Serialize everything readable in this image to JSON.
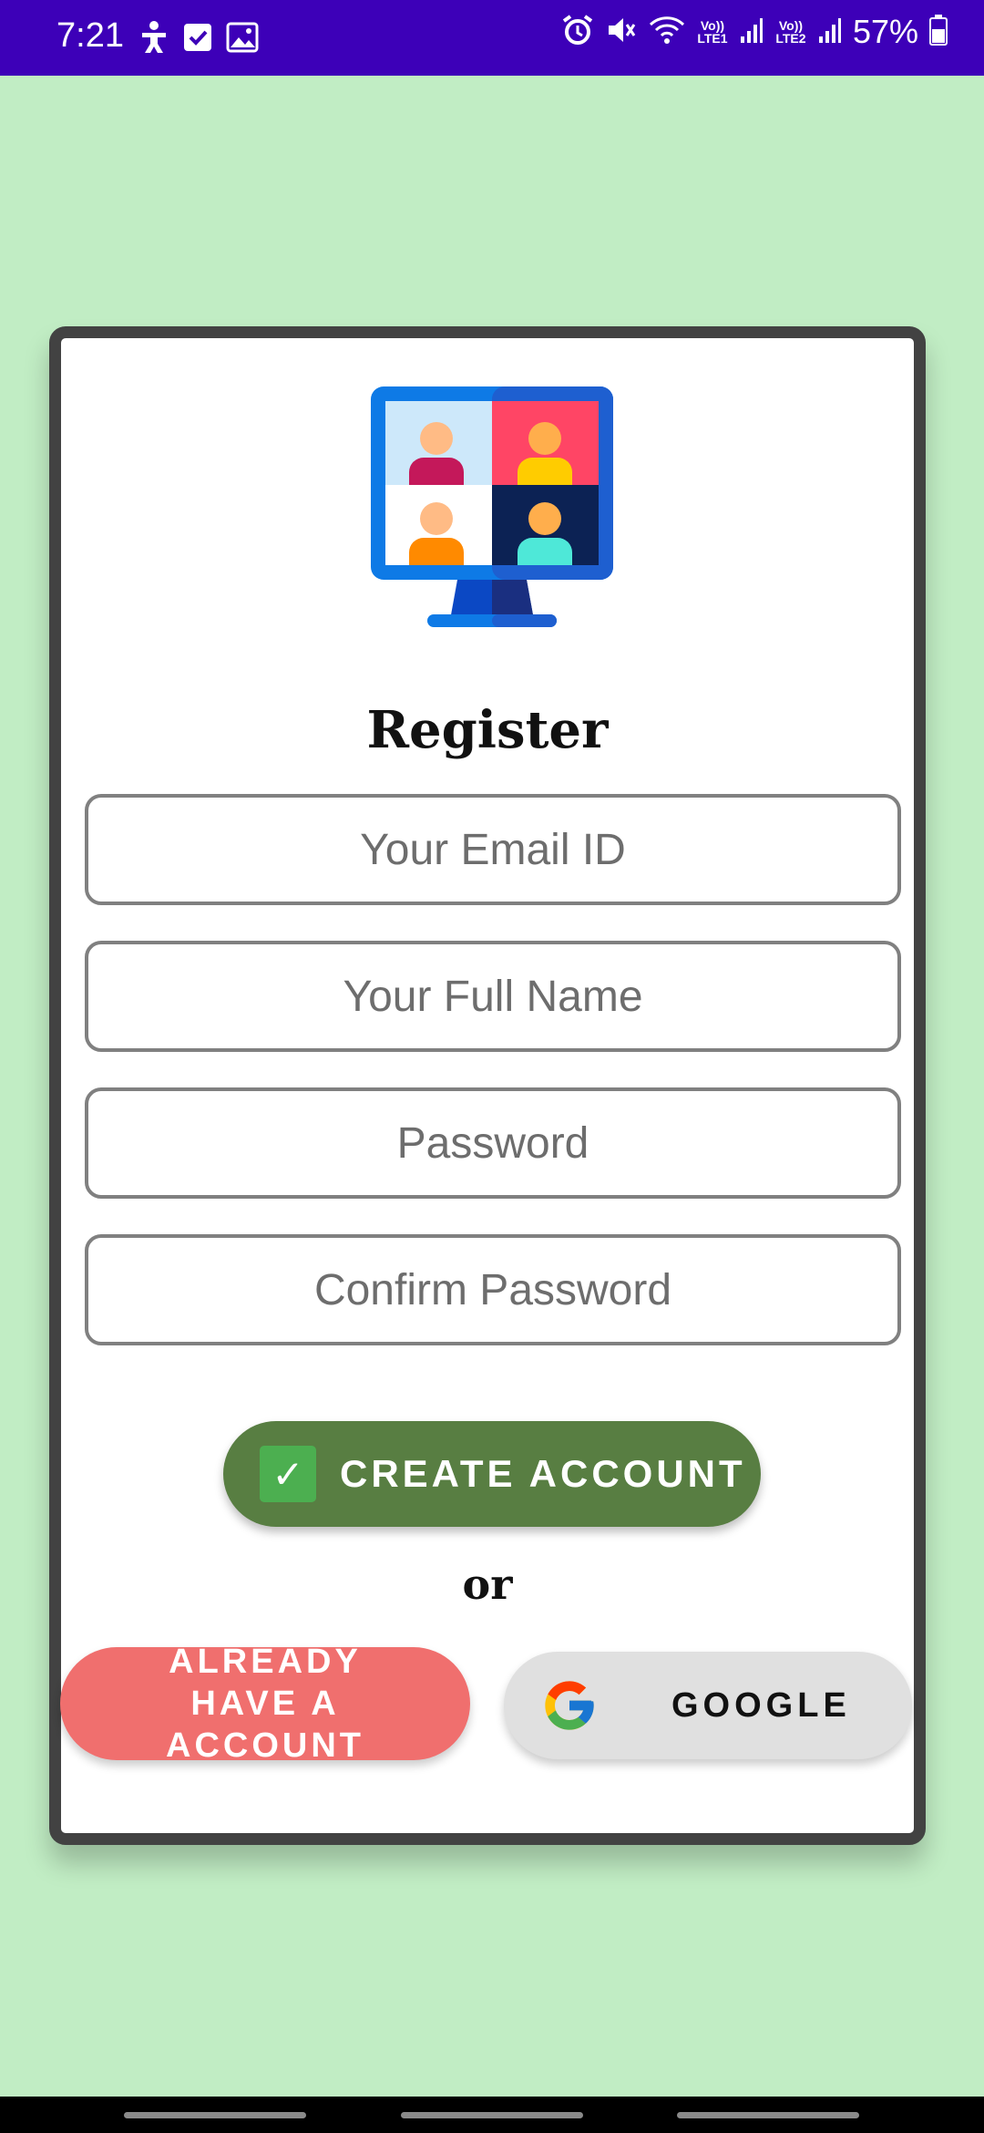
{
  "status_bar": {
    "time": "7:21",
    "battery": "57%",
    "sim1_label": "Vo)) LTE1",
    "sim2_label": "Vo)) LTE2",
    "icons": [
      "accessibility-icon",
      "checkbox-icon",
      "image-icon",
      "alarm-icon",
      "mute-icon",
      "wifi-icon",
      "signal-icon",
      "battery-icon"
    ]
  },
  "form": {
    "title": "Register",
    "email_placeholder": "Your Email ID",
    "name_placeholder": "Your Full Name",
    "password_placeholder": "Password",
    "confirm_placeholder": "Confirm Password",
    "create_label": "CREATE ACCOUNT",
    "or_text": "or",
    "already_label": "ALREADY HAVE A ACCOUNT",
    "google_label": "GOOGLE"
  },
  "colors": {
    "status_bar": "#3d00b8",
    "background": "#c1edc4",
    "create_button": "#587e42",
    "already_button": "#f06f6e",
    "google_button": "#e0e0e0"
  }
}
